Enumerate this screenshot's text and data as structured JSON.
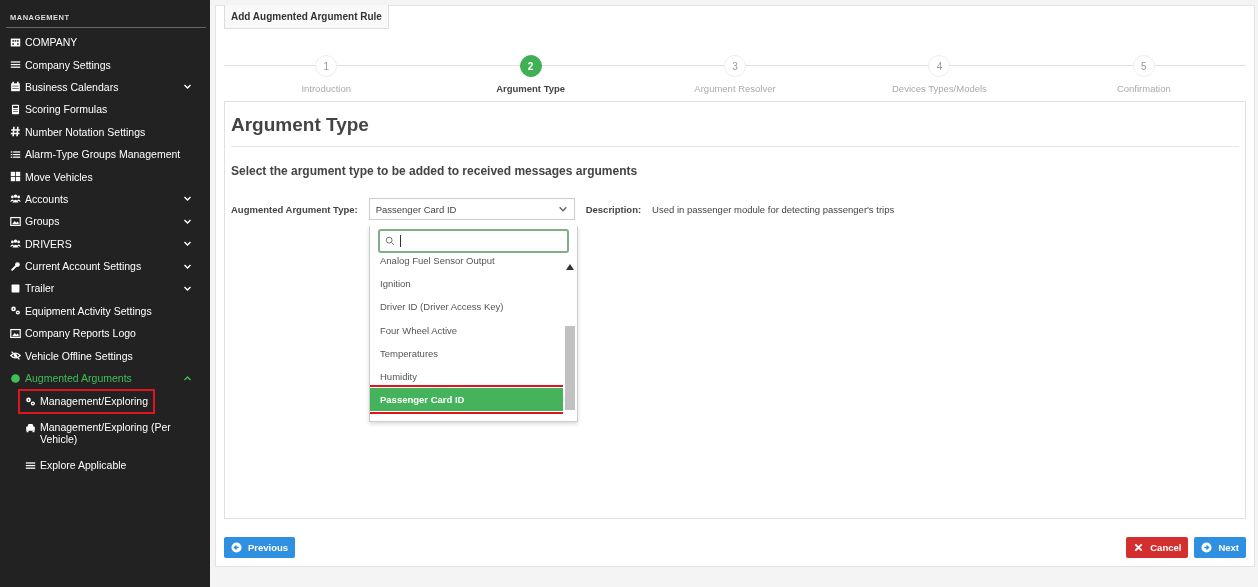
{
  "sidebar": {
    "heading": "MANAGEMENT",
    "items": [
      {
        "label": "COMPANY",
        "kind": "building",
        "selected": false
      },
      {
        "label": "Company Settings",
        "kind": "bars",
        "selected": false
      },
      {
        "label": "Business Calendars",
        "kind": "calendar",
        "selected": false,
        "expanded": false
      },
      {
        "label": "Scoring Formulas",
        "kind": "calculator",
        "selected": false
      },
      {
        "label": "Number Notation Settings",
        "kind": "hash",
        "selected": false
      },
      {
        "label": "Alarm-Type Groups Management",
        "kind": "list",
        "selected": false
      },
      {
        "label": "Move Vehicles",
        "kind": "grid",
        "selected": false
      },
      {
        "label": "Accounts",
        "kind": "users",
        "selected": false,
        "expanded": false
      },
      {
        "label": "Groups",
        "kind": "image",
        "selected": false,
        "expanded": false
      },
      {
        "label": "DRIVERS",
        "kind": "users",
        "selected": false,
        "expanded": false
      },
      {
        "label": "Current Account Settings",
        "kind": "wrench",
        "selected": false,
        "expanded": false
      },
      {
        "label": "Trailer",
        "kind": "square",
        "selected": false,
        "expanded": false
      },
      {
        "label": "Equipment Activity Settings",
        "kind": "gears",
        "selected": false
      },
      {
        "label": "Company Reports Logo",
        "kind": "image",
        "selected": false
      },
      {
        "label": "Vehicle Offline Settings",
        "kind": "eye-slash",
        "selected": false
      },
      {
        "label": "Augmented Arguments",
        "kind": "circle",
        "selected": true,
        "expanded": true,
        "children": [
          {
            "label": "Management/Exploring",
            "kind": "gears",
            "highlighted": true
          },
          {
            "label": "Management/Exploring (Per Vehicle)",
            "kind": "car",
            "highlighted": false
          },
          {
            "label": "Explore Applicable",
            "kind": "bars",
            "highlighted": false
          }
        ]
      }
    ]
  },
  "panel": {
    "legend": "Add Augmented Argument Rule",
    "steps": [
      {
        "number": "1",
        "label": "Introduction",
        "selected": false
      },
      {
        "number": "2",
        "label": "Argument Type",
        "selected": true
      },
      {
        "number": "3",
        "label": "Argument Resolver",
        "selected": false
      },
      {
        "number": "4",
        "label": "Devices Types/Models",
        "selected": false
      },
      {
        "number": "5",
        "label": "Confirmation",
        "selected": false
      }
    ],
    "title": "Argument Type",
    "subtitle": "Select the argument type to be added to received messages arguments",
    "field": {
      "label": "Augmented Argument Type:",
      "value": "Passenger Card ID",
      "description_label": "Description:",
      "description": "Used in passenger module for detecting passenger's trips"
    },
    "dropdown": {
      "options": [
        {
          "label": "Analog Fuel Sensor Output",
          "selected": false,
          "highlighted": false
        },
        {
          "label": "Ignition",
          "selected": false,
          "highlighted": false
        },
        {
          "label": "Driver ID (Driver Access Key)",
          "selected": false,
          "highlighted": false
        },
        {
          "label": "Four Wheel Active",
          "selected": false,
          "highlighted": false
        },
        {
          "label": "Temperatures",
          "selected": false,
          "highlighted": false
        },
        {
          "label": "Humidity",
          "selected": false,
          "highlighted": false
        },
        {
          "label": "Passenger Card ID",
          "selected": true,
          "highlighted": true
        }
      ]
    },
    "buttons": [
      {
        "label": "Previous",
        "kind": "previous"
      },
      {
        "label": "Cancel",
        "kind": "cancel"
      },
      {
        "label": "Next",
        "kind": "next"
      }
    ]
  }
}
